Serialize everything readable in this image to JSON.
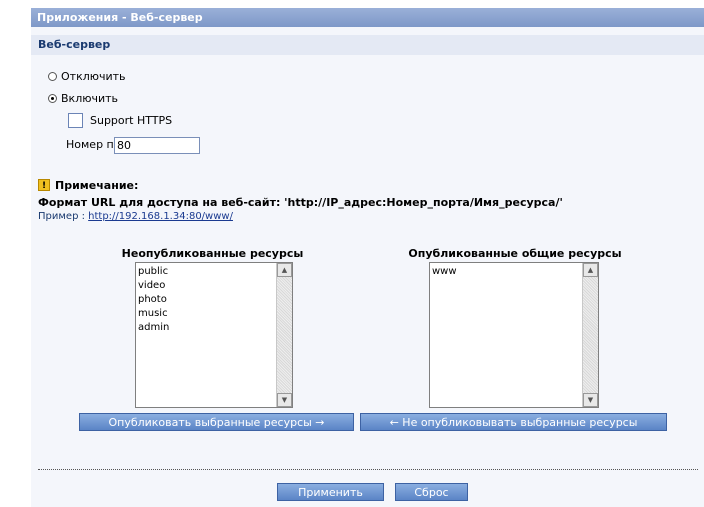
{
  "window": {
    "title": "Приложения - Веб-сервер"
  },
  "section": {
    "title": "Веб-сервер"
  },
  "options": {
    "disable_label": "Отключить",
    "enable_label": "Включить",
    "https_label": "Support HTTPS",
    "port_label": "Номер порта",
    "port_value": "80"
  },
  "note": {
    "title": "Примечание:",
    "format": "Формат URL для доступа на веб-сайт: 'http://IP_адрес:Номер_порта/Имя_ресурса/'",
    "example_label": "Пример :",
    "example_link": "http://192.168.1.34:80/www/"
  },
  "unpublished": {
    "title": "Неопубликованные ресурсы",
    "items": [
      "public",
      "video",
      "photo",
      "music",
      "admin"
    ]
  },
  "published": {
    "title": "Опубликованные общие ресурсы",
    "items": [
      "www"
    ]
  },
  "buttons": {
    "publish": "Опубликовать выбранные ресурсы   →",
    "unpublish": "←   Не опубликовывать выбранные ресурсы",
    "apply": "Применить",
    "reset": "Сброс"
  },
  "icons": {
    "note": "info-warning-icon",
    "scroll_up": "scroll-up-icon",
    "scroll_down": "scroll-down-icon"
  }
}
